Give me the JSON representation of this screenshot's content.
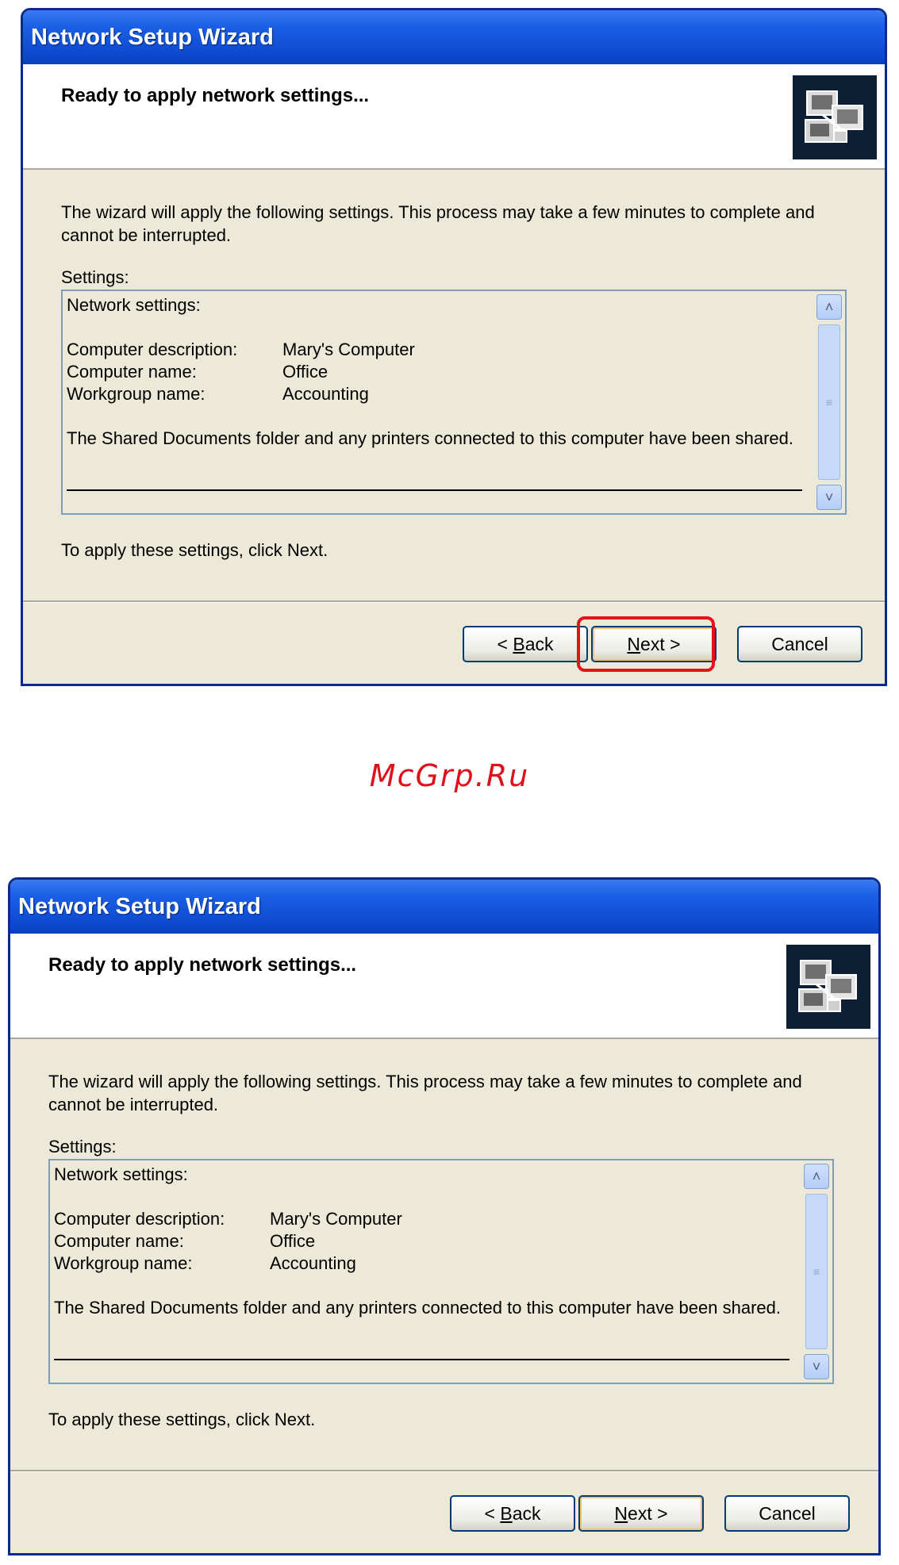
{
  "dialogs": [
    {
      "title": "Network Setup Wizard",
      "heading": "Ready to apply network settings...",
      "intro": "The wizard will apply the following settings. This process may take a few minutes to complete and cannot be interrupted.",
      "settings_label": "Settings:",
      "settings": {
        "section_title": "Network settings:",
        "rows": [
          {
            "key": "Computer description:",
            "value": "Mary's Computer"
          },
          {
            "key": "Computer name:",
            "value": "Office"
          },
          {
            "key": "Workgroup name:",
            "value": "Accounting"
          }
        ],
        "shared_note": "The Shared Documents folder and any printers connected to this computer have been shared."
      },
      "apply_text": "To apply these settings, click Next.",
      "buttons": {
        "back_prefix": "< ",
        "back_accel": "B",
        "back_rest": "ack",
        "next_accel": "N",
        "next_rest": "ext >",
        "cancel": "Cancel"
      }
    },
    {
      "title": "Network Setup Wizard",
      "heading": "Ready to apply network settings...",
      "intro": "The wizard will apply the following settings. This process may take a few minutes to complete and cannot be interrupted.",
      "settings_label": "Settings:",
      "settings": {
        "section_title": "Network settings:",
        "rows": [
          {
            "key": "Computer description:",
            "value": "Mary's Computer"
          },
          {
            "key": "Computer name:",
            "value": "Office"
          },
          {
            "key": "Workgroup name:",
            "value": "Accounting"
          }
        ],
        "shared_note": "The Shared Documents folder and any printers connected to this computer have been shared."
      },
      "apply_text": "To apply these settings, click Next.",
      "buttons": {
        "back_prefix": "< ",
        "back_accel": "B",
        "back_rest": "ack",
        "next_accel": "N",
        "next_rest": "ext >",
        "cancel": "Cancel"
      }
    }
  ],
  "watermark": "McGrp.Ru",
  "colors": {
    "highlight": "#e3131b",
    "titlebar": "#0d4ad0",
    "dialog_bg": "#ece9d8"
  },
  "icons": {
    "header": "network-computers-icon",
    "scroll_up": "chevron-up-icon",
    "scroll_down": "chevron-down-icon"
  }
}
